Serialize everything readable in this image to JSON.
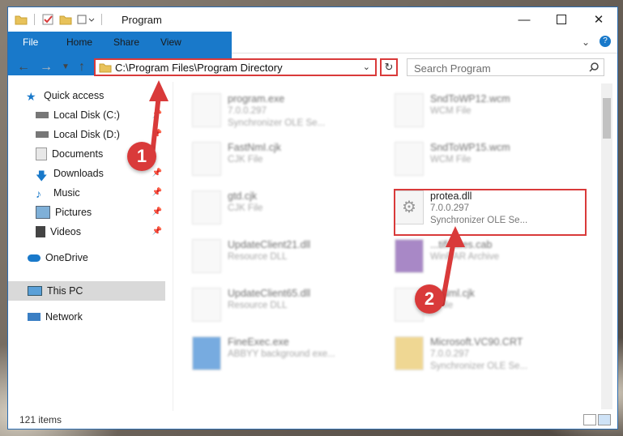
{
  "window": {
    "title": "Program"
  },
  "ribbon": {
    "tabs": [
      "File",
      "Home",
      "Share",
      "View"
    ]
  },
  "address": {
    "path": "C:\\Program Files\\Program Directory",
    "search_placeholder": "Search Program"
  },
  "nav": {
    "items": [
      {
        "label": "Quick access",
        "icon": "star-icon"
      },
      {
        "label": "Local Disk (C:)",
        "icon": "drive-icon"
      },
      {
        "label": "Local Disk (D:)",
        "icon": "drive-icon"
      },
      {
        "label": "Documents",
        "icon": "documents-icon"
      },
      {
        "label": "Downloads",
        "icon": "downloads-icon"
      },
      {
        "label": "Music",
        "icon": "music-icon"
      },
      {
        "label": "Pictures",
        "icon": "pictures-icon"
      },
      {
        "label": "Videos",
        "icon": "videos-icon"
      },
      {
        "label": "OneDrive",
        "icon": "cloud-icon"
      },
      {
        "label": "This PC",
        "icon": "computer-icon"
      },
      {
        "label": "Network",
        "icon": "network-icon"
      }
    ]
  },
  "files": [
    {
      "name": "program.exe",
      "l2": "7.0.0.297",
      "l3": "Synchronizer OLE Se..."
    },
    {
      "name": "SndToWP12.wcm",
      "l2": "WCM File",
      "l3": ""
    },
    {
      "name": "FastNmI.cjk",
      "l2": "CJK File",
      "l3": ""
    },
    {
      "name": "SndToWP15.wcm",
      "l2": "WCM File",
      "l3": ""
    },
    {
      "name": "gtd.cjk",
      "l2": "CJK File",
      "l3": ""
    },
    {
      "name": "protea.dll",
      "l2": "7.0.0.297",
      "l3": "Synchronizer OLE Se..."
    },
    {
      "name": "UpdateClient21.dll",
      "l2": "Resource DLL",
      "l3": ""
    },
    {
      "name": "...tificates.cab",
      "l2": "WinRAR Archive",
      "l3": ""
    },
    {
      "name": "UpdateClient65.dll",
      "l2": "Resource DLL",
      "l3": ""
    },
    {
      "name": "...tNml.cjk",
      "l2": "...File",
      "l3": ""
    },
    {
      "name": "FineExec.exe",
      "l2": "ABBYY background exe...",
      "l3": ""
    },
    {
      "name": "Microsoft.VC90.CRT",
      "l2": "7.0.0.297",
      "l3": "Synchronizer OLE Se..."
    }
  ],
  "status": {
    "count": "121 items"
  },
  "callouts": [
    "1",
    "2"
  ],
  "colors": {
    "accent": "#1979ca",
    "highlight": "#d93a3a"
  }
}
